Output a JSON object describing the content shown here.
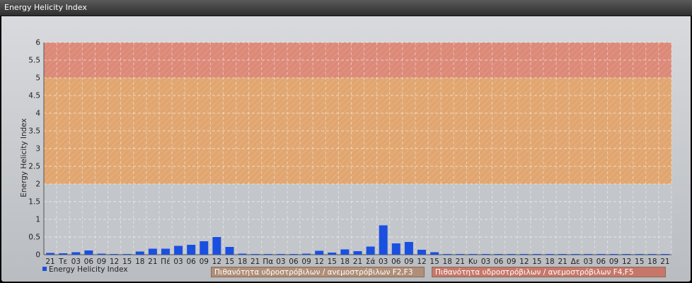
{
  "window": {
    "title": "Energy Helicity Index"
  },
  "chart_data": {
    "type": "bar",
    "title": "",
    "ylabel": "Energy Helicity Index",
    "xlabel": "",
    "ylim": [
      0,
      6
    ],
    "yticks": [
      "0",
      "0.5",
      "1",
      "1.5",
      "2",
      "2.5",
      "3",
      "3.5",
      "4",
      "4.5",
      "5",
      "5.5",
      "6"
    ],
    "grid": true,
    "legend_position": "bottom-left",
    "categories": [
      "21",
      "Τε",
      "03",
      "06",
      "09",
      "12",
      "15",
      "18",
      "21",
      "Πέ",
      "03",
      "06",
      "09",
      "12",
      "15",
      "18",
      "21",
      "Πα",
      "03",
      "06",
      "09",
      "12",
      "15",
      "18",
      "21",
      "Σά",
      "03",
      "06",
      "09",
      "12",
      "15",
      "18",
      "21",
      "Κυ",
      "03",
      "06",
      "09",
      "12",
      "15",
      "18",
      "21",
      "Δε",
      "03",
      "06",
      "09",
      "12",
      "15",
      "18",
      "21"
    ],
    "series": [
      {
        "name": "Energy Helicity Index",
        "color": "#1a4fe0",
        "values": [
          0.05,
          0.04,
          0.07,
          0.12,
          0.03,
          0.02,
          0.02,
          0.09,
          0.17,
          0.17,
          0.25,
          0.28,
          0.38,
          0.5,
          0.22,
          0.03,
          0.02,
          0.02,
          0.02,
          0.02,
          0.03,
          0.11,
          0.06,
          0.15,
          0.1,
          0.23,
          0.83,
          0.32,
          0.36,
          0.14,
          0.07,
          0.01,
          0.01,
          0.01,
          0.01,
          0.01,
          0.01,
          0.01,
          0.01,
          0.01,
          0.01,
          0.01,
          0.01,
          0.01,
          0.01,
          0.01,
          0.01,
          0.01,
          0.01
        ]
      }
    ],
    "bands": [
      {
        "name": "Πιθανότητα υδροστρόβιλων / ανεμοστρόβιλων F2,F3",
        "from": 2,
        "to": 5,
        "color": "#e6a060"
      },
      {
        "name": "Πιθανότητα υδροστρόβιλων / ανεμοστρόβιλων F4,F5",
        "from": 5,
        "to": 6,
        "color": "#e07e6a"
      }
    ]
  }
}
